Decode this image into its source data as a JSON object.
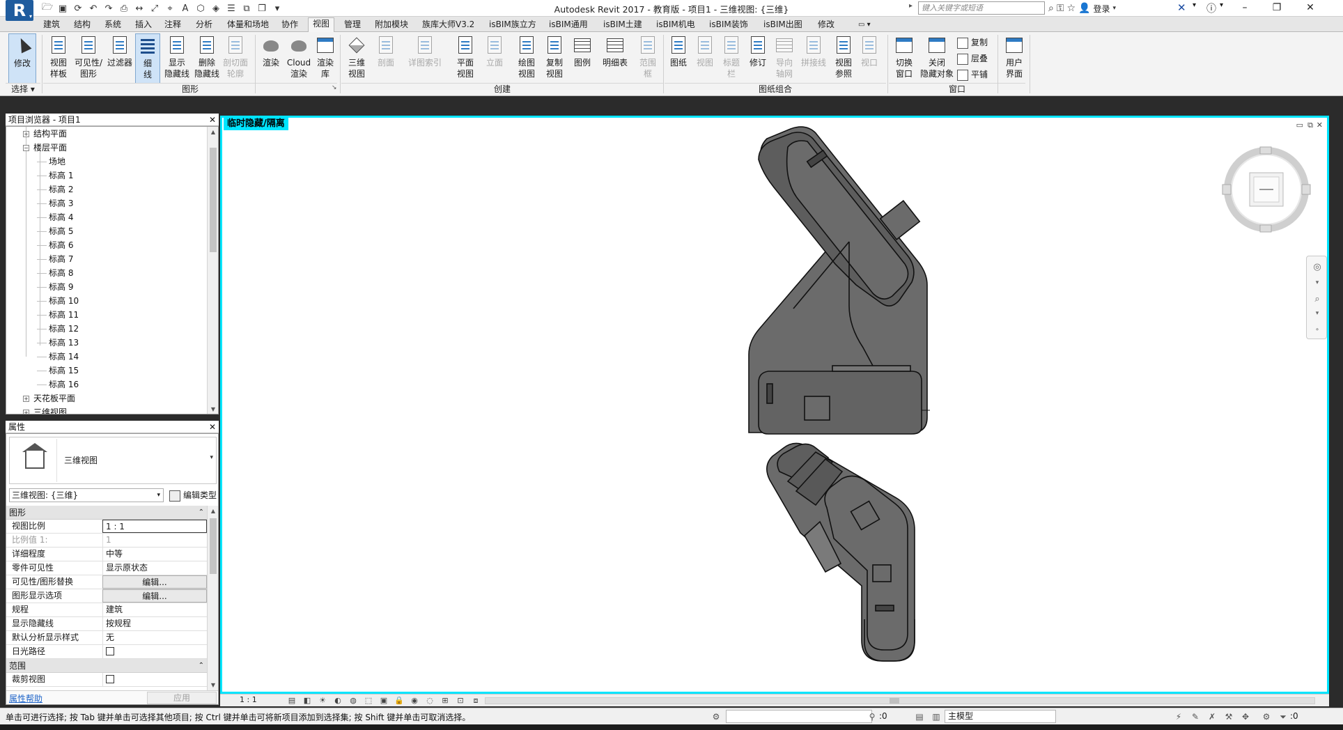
{
  "window": {
    "title": "Autodesk Revit 2017 - 教育版 -    项目1 - 三维视图: {三维}",
    "search_placeholder": "键入关键字或短语",
    "login_label": "登录"
  },
  "tabs": [
    "建筑",
    "结构",
    "系统",
    "插入",
    "注释",
    "分析",
    "体量和场地",
    "协作",
    "视图",
    "管理",
    "附加模块",
    "族库大师V3.2",
    "isBIM族立方",
    "isBIM通用",
    "isBIM土建",
    "isBIM机电",
    "isBIM装饰",
    "isBIM出图",
    "修改"
  ],
  "active_tab": "视图",
  "ribbon": {
    "modify": {
      "label": "修改",
      "panel": "选择"
    },
    "graphics": {
      "panel": "图形",
      "buttons": [
        {
          "label": "视图\n样板"
        },
        {
          "label": "可见性/\n图形"
        },
        {
          "label": "过滤器"
        },
        {
          "label": "细\n线"
        },
        {
          "label": "显示\n隐藏线"
        },
        {
          "label": "删除\n隐藏线"
        },
        {
          "label": "剖切面\n轮廓"
        }
      ]
    },
    "presentation": {
      "buttons": [
        {
          "label": "渲染"
        },
        {
          "label": "Cloud\n渲染"
        },
        {
          "label": "渲染\n库"
        }
      ]
    },
    "create": {
      "panel": "创建",
      "buttons": [
        {
          "label": "三维\n视图"
        },
        {
          "label": "剖面"
        },
        {
          "label": "详图索引"
        },
        {
          "label": "平面\n视图"
        },
        {
          "label": "立面"
        },
        {
          "label": "绘图\n视图"
        },
        {
          "label": "复制\n视图"
        },
        {
          "label": "图例"
        },
        {
          "label": "明细表"
        },
        {
          "label": "范围\n框"
        }
      ]
    },
    "sheet": {
      "panel": "图纸组合",
      "buttons": [
        {
          "label": "图纸"
        },
        {
          "label": "视图"
        },
        {
          "label": "标题\n栏"
        },
        {
          "label": "修订"
        },
        {
          "label": "导向\n轴网"
        },
        {
          "label": "拼接线"
        },
        {
          "label": "视图\n参照"
        },
        {
          "label": "视口"
        }
      ]
    },
    "windows": {
      "panel": "窗口",
      "buttons": [
        {
          "label": "切换\n窗口"
        },
        {
          "label": "关闭\n隐藏对象"
        }
      ],
      "small_buttons": [
        {
          "label": "复制"
        },
        {
          "label": "层叠"
        },
        {
          "label": "平铺"
        }
      ],
      "ui_button": {
        "label": "用户\n界面"
      }
    }
  },
  "project_browser": {
    "title": "项目浏览器 - 项目1",
    "items": [
      {
        "label": "结构平面",
        "level": 1,
        "toggle": "+"
      },
      {
        "label": "楼层平面",
        "level": 1,
        "toggle": "−"
      },
      {
        "label": "场地",
        "level": 2
      },
      {
        "label": "标高 1",
        "level": 2
      },
      {
        "label": "标高 2",
        "level": 2
      },
      {
        "label": "标高 3",
        "level": 2
      },
      {
        "label": "标高 4",
        "level": 2
      },
      {
        "label": "标高 5",
        "level": 2
      },
      {
        "label": "标高 6",
        "level": 2
      },
      {
        "label": "标高 7",
        "level": 2
      },
      {
        "label": "标高 8",
        "level": 2
      },
      {
        "label": "标高 9",
        "level": 2
      },
      {
        "label": "标高 10",
        "level": 2
      },
      {
        "label": "标高 11",
        "level": 2
      },
      {
        "label": "标高 12",
        "level": 2
      },
      {
        "label": "标高 13",
        "level": 2
      },
      {
        "label": "标高 14",
        "level": 2
      },
      {
        "label": "标高 15",
        "level": 2
      },
      {
        "label": "标高 16",
        "level": 2
      },
      {
        "label": "天花板平面",
        "level": 1,
        "toggle": "+"
      },
      {
        "label": "三维视图",
        "level": 1,
        "toggle": "+"
      }
    ]
  },
  "properties": {
    "title": "属性",
    "type_name": "三维视图",
    "selector": "三维视图: {三维}",
    "edit_type": "编辑类型",
    "sections": [
      {
        "name": "图形",
        "rows": [
          {
            "key": "视图比例",
            "value": "1 : 1",
            "kind": "input"
          },
          {
            "key": "比例值 1:",
            "value": "1",
            "kind": "disabled"
          },
          {
            "key": "详细程度",
            "value": "中等",
            "kind": "text"
          },
          {
            "key": "零件可见性",
            "value": "显示原状态",
            "kind": "text"
          },
          {
            "key": "可见性/图形替换",
            "value": "编辑...",
            "kind": "button"
          },
          {
            "key": "图形显示选项",
            "value": "编辑...",
            "kind": "button"
          },
          {
            "key": "规程",
            "value": "建筑",
            "kind": "text"
          },
          {
            "key": "显示隐藏线",
            "value": "按规程",
            "kind": "text"
          },
          {
            "key": "默认分析显示样式",
            "value": "无",
            "kind": "text"
          },
          {
            "key": "日光路径",
            "value": "",
            "kind": "check"
          }
        ]
      },
      {
        "name": "范围",
        "rows": [
          {
            "key": "裁剪视图",
            "value": "",
            "kind": "check"
          }
        ]
      }
    ],
    "help_link": "属性帮助",
    "apply_button": "应用"
  },
  "view": {
    "banner": "临时隐藏/隔离",
    "scale": "1 : 1",
    "viewcube_face": "—"
  },
  "status": {
    "message": "单击可进行选择; 按 Tab 键并单击可选择其他项目; 按 Ctrl 键并单击可将新项目添加到选择集; 按 Shift 键并单击可取消选择。",
    "counter_a": ":0",
    "model": "主模型",
    "counter_b": ":0"
  },
  "colors": {
    "highlight": "#00e5ff",
    "model_fill": "#6b6b6b",
    "ribbon_bg": "#f3f3f3"
  }
}
